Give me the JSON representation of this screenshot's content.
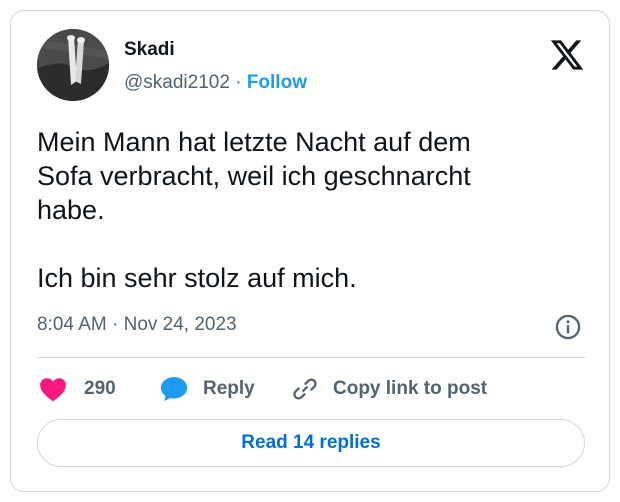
{
  "author": {
    "display_name": "Skadi",
    "handle": "@skadi2102",
    "separator": "·",
    "follow_label": "Follow"
  },
  "tweet": {
    "text": "Mein Mann hat letzte Nacht auf dem\nSofa verbracht, weil ich geschnarcht\nhabe.\n\nIch bin sehr stolz auf mich.",
    "timestamp": "8:04 AM · Nov 24, 2023"
  },
  "actions": {
    "like_count": "290",
    "reply_label": "Reply",
    "copy_label": "Copy link to post"
  },
  "footer": {
    "read_replies_label": "Read 14 replies"
  },
  "colors": {
    "like": "#f91880",
    "reply": "#1d9bf0",
    "link": "#006fd6",
    "muted": "#536471"
  },
  "icons": [
    "x-logo-icon",
    "info-icon",
    "heart-icon",
    "reply-bubble-icon",
    "link-icon"
  ]
}
